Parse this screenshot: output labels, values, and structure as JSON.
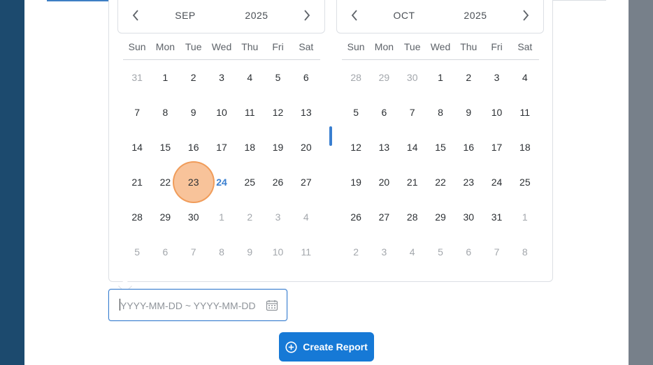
{
  "calendars": [
    {
      "month": "SEP",
      "year": "2025",
      "weekdays": [
        "Sun",
        "Mon",
        "Tue",
        "Wed",
        "Thu",
        "Fri",
        "Sat"
      ],
      "weeks": [
        [
          {
            "d": "31",
            "m": true
          },
          {
            "d": "1"
          },
          {
            "d": "2"
          },
          {
            "d": "3"
          },
          {
            "d": "4"
          },
          {
            "d": "5"
          },
          {
            "d": "6"
          }
        ],
        [
          {
            "d": "7"
          },
          {
            "d": "8"
          },
          {
            "d": "9"
          },
          {
            "d": "10"
          },
          {
            "d": "11"
          },
          {
            "d": "12"
          },
          {
            "d": "13"
          }
        ],
        [
          {
            "d": "14"
          },
          {
            "d": "15"
          },
          {
            "d": "16"
          },
          {
            "d": "17"
          },
          {
            "d": "18"
          },
          {
            "d": "19"
          },
          {
            "d": "20"
          }
        ],
        [
          {
            "d": "21"
          },
          {
            "d": "22"
          },
          {
            "d": "23",
            "hover": true
          },
          {
            "d": "24",
            "today": true
          },
          {
            "d": "25"
          },
          {
            "d": "26"
          },
          {
            "d": "27"
          }
        ],
        [
          {
            "d": "28"
          },
          {
            "d": "29"
          },
          {
            "d": "30"
          },
          {
            "d": "1",
            "m": true
          },
          {
            "d": "2",
            "m": true
          },
          {
            "d": "3",
            "m": true
          },
          {
            "d": "4",
            "m": true
          }
        ],
        [
          {
            "d": "5",
            "m": true
          },
          {
            "d": "6",
            "m": true
          },
          {
            "d": "7",
            "m": true
          },
          {
            "d": "8",
            "m": true
          },
          {
            "d": "9",
            "m": true
          },
          {
            "d": "10",
            "m": true
          },
          {
            "d": "11",
            "m": true
          }
        ]
      ]
    },
    {
      "month": "OCT",
      "year": "2025",
      "weekdays": [
        "Sun",
        "Mon",
        "Tue",
        "Wed",
        "Thu",
        "Fri",
        "Sat"
      ],
      "weeks": [
        [
          {
            "d": "28",
            "m": true
          },
          {
            "d": "29",
            "m": true
          },
          {
            "d": "30",
            "m": true
          },
          {
            "d": "1"
          },
          {
            "d": "2"
          },
          {
            "d": "3"
          },
          {
            "d": "4"
          }
        ],
        [
          {
            "d": "5"
          },
          {
            "d": "6"
          },
          {
            "d": "7"
          },
          {
            "d": "8"
          },
          {
            "d": "9"
          },
          {
            "d": "10"
          },
          {
            "d": "11"
          }
        ],
        [
          {
            "d": "12"
          },
          {
            "d": "13"
          },
          {
            "d": "14"
          },
          {
            "d": "15"
          },
          {
            "d": "16"
          },
          {
            "d": "17"
          },
          {
            "d": "18"
          }
        ],
        [
          {
            "d": "19"
          },
          {
            "d": "20"
          },
          {
            "d": "21"
          },
          {
            "d": "22"
          },
          {
            "d": "23"
          },
          {
            "d": "24"
          },
          {
            "d": "25"
          }
        ],
        [
          {
            "d": "26"
          },
          {
            "d": "27"
          },
          {
            "d": "28"
          },
          {
            "d": "29"
          },
          {
            "d": "30"
          },
          {
            "d": "31"
          },
          {
            "d": "1",
            "m": true
          }
        ],
        [
          {
            "d": "2",
            "m": true
          },
          {
            "d": "3",
            "m": true
          },
          {
            "d": "4",
            "m": true
          },
          {
            "d": "5",
            "m": true
          },
          {
            "d": "6",
            "m": true
          },
          {
            "d": "7",
            "m": true
          },
          {
            "d": "8",
            "m": true
          }
        ]
      ]
    }
  ],
  "date_input": {
    "value": "",
    "placeholder": "YYYY-MM-DD ~ YYYY-MM-DD"
  },
  "create_button": {
    "label": "Create Report"
  },
  "icons": {
    "prev": "chevron-left-icon",
    "next": "chevron-right-icon",
    "calendar": "calendar-icon",
    "create": "plus-circle-icon"
  },
  "colors": {
    "accent": "#1679d6",
    "today": "#3a7fd0",
    "hover_highlight": "#f6af78",
    "sidebar_left": "#1c4a6e",
    "sidebar_right": "#77808a"
  }
}
